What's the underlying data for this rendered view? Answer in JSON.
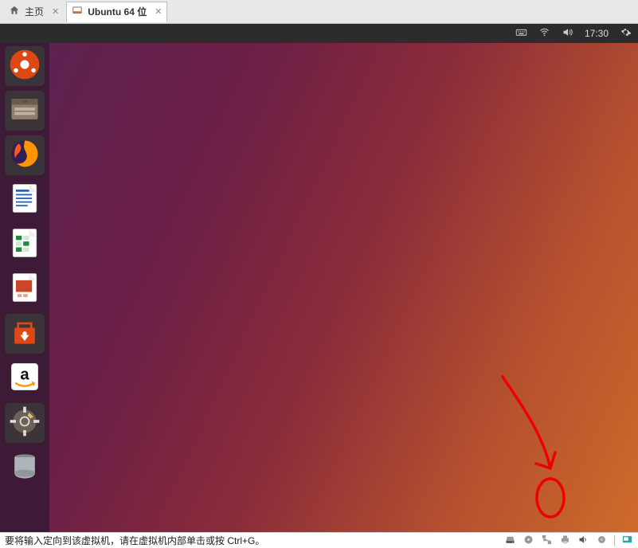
{
  "vm_tabs": {
    "home": {
      "label": "主页"
    },
    "active": {
      "label": "Ubuntu 64 位"
    }
  },
  "ubuntu_top": {
    "time": "17:30"
  },
  "launcher": {
    "items": [
      {
        "id": "dash",
        "name": "search-icon"
      },
      {
        "id": "files",
        "name": "files-icon"
      },
      {
        "id": "firefox",
        "name": "firefox-icon"
      },
      {
        "id": "writer",
        "name": "libreoffice-writer-icon"
      },
      {
        "id": "calc",
        "name": "libreoffice-calc-icon"
      },
      {
        "id": "impress",
        "name": "libreoffice-impress-icon"
      },
      {
        "id": "software",
        "name": "ubuntu-software-icon"
      },
      {
        "id": "amazon",
        "name": "amazon-icon"
      },
      {
        "id": "settings",
        "name": "settings-icon"
      },
      {
        "id": "trash",
        "name": "trash-icon"
      }
    ]
  },
  "status_bar": {
    "message": "要将输入定向到该虚拟机，请在虚拟机内部单击或按 Ctrl+G。"
  }
}
